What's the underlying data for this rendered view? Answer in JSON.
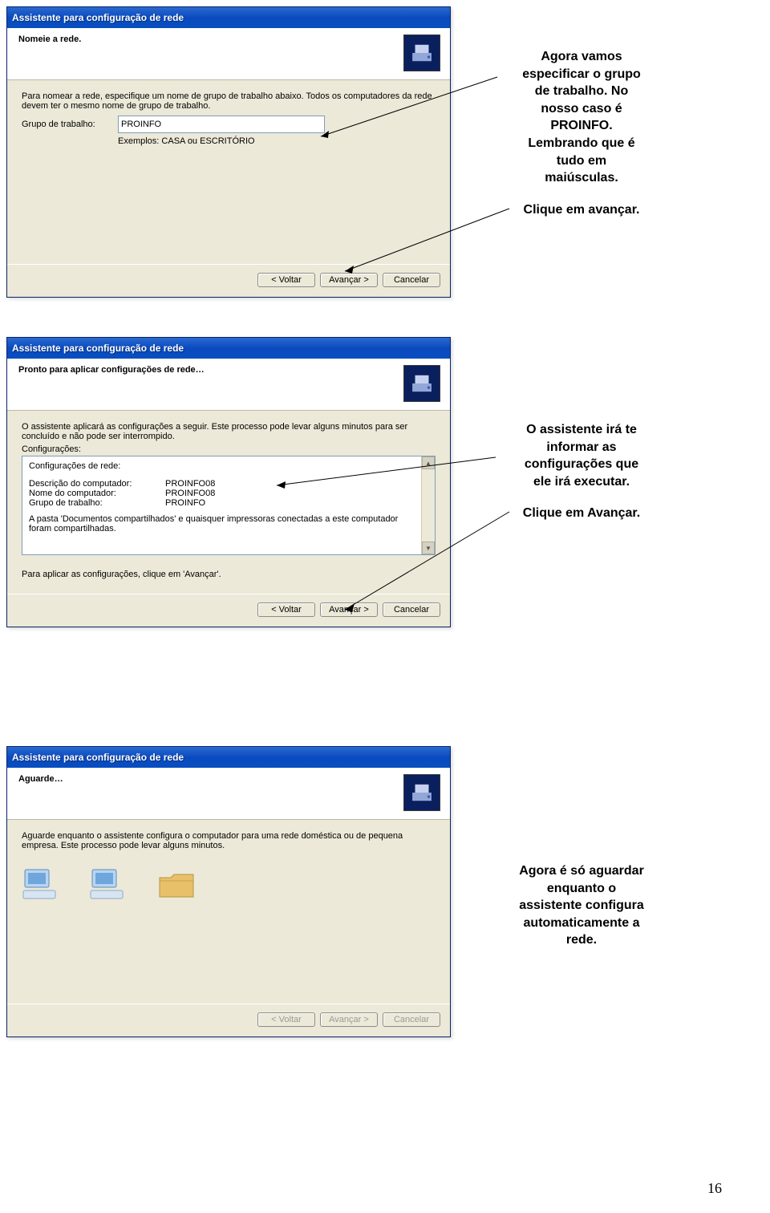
{
  "annotations": {
    "a1_l1": "Agora vamos",
    "a1_l2": "especificar o grupo",
    "a1_l3": "de trabalho. No",
    "a1_l4": "nosso caso é",
    "a1_l5": "PROINFO.",
    "a1_l6": "Lembrando que é",
    "a1_l7": "tudo em",
    "a1_l8": "maiúsculas.",
    "a1_footer": "Clique em avançar.",
    "a2_l1": "O assistente irá te",
    "a2_l2": "informar as",
    "a2_l3": "configurações que",
    "a2_l4": "ele irá executar.",
    "a2_footer": "Clique em Avançar.",
    "a3_l1": "Agora é só aguardar",
    "a3_l2": "enquanto o",
    "a3_l3": "assistente configura",
    "a3_l4": "automaticamente a",
    "a3_l5": "rede."
  },
  "dialog1": {
    "title": "Assistente para configuração de rede",
    "header": "Nomeie a rede.",
    "body_p1": "Para nomear a rede, especifique um nome de grupo de trabalho abaixo. Todos os computadores da rede devem ter o mesmo nome de grupo de trabalho.",
    "workgroup_label": "Grupo de trabalho:",
    "workgroup_value": "PROINFO",
    "examples": "Exemplos: CASA ou ESCRITÓRIO",
    "btn_back": "< Voltar",
    "btn_next": "Avançar >",
    "btn_cancel": "Cancelar"
  },
  "dialog2": {
    "title": "Assistente para configuração de rede",
    "header": "Pronto para aplicar configurações de rede…",
    "body_p1": "O assistente aplicará as configurações a seguir. Este processo pode levar alguns minutos para ser concluído e não pode ser interrompido.",
    "config_label": "Configurações:",
    "box_line1": "Configurações de rede:",
    "row1_label": "Descrição do computador:",
    "row1_value": "PROINFO08",
    "row2_label": "Nome do computador:",
    "row2_value": "PROINFO08",
    "row3_label": "Grupo de trabalho:",
    "row3_value": "PROINFO",
    "box_p2": "A pasta 'Documentos compartilhados' e quaisquer impressoras conectadas a este computador foram compartilhadas.",
    "footer_p": "Para aplicar as configurações, clique em 'Avançar'.",
    "btn_back": "< Voltar",
    "btn_next": "Avançar >",
    "btn_cancel": "Cancelar"
  },
  "dialog3": {
    "title": "Assistente para configuração de rede",
    "header": "Aguarde…",
    "body_p1": "Aguarde enquanto o assistente configura o computador para uma rede doméstica ou de pequena empresa. Este processo pode levar alguns minutos.",
    "btn_back": "< Voltar",
    "btn_next": "Avançar >",
    "btn_cancel": "Cancelar"
  },
  "page_number": "16"
}
